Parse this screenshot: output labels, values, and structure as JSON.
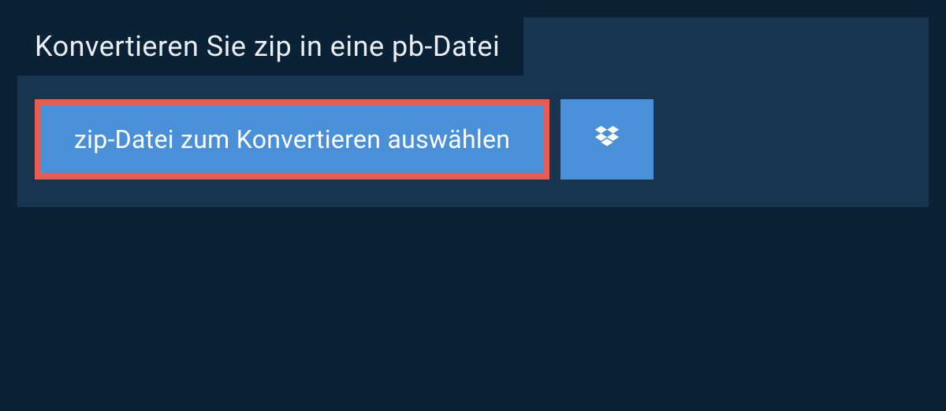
{
  "panel": {
    "title": "Konvertieren Sie zip in eine pb-Datei",
    "select_button_label": "zip-Datei zum Konvertieren auswählen",
    "dropbox_icon_name": "dropbox-icon"
  },
  "colors": {
    "page_bg": "#0b2236",
    "panel_bg": "#17354f",
    "button_bg": "#4a90d9",
    "button_border": "#e85d52",
    "text_light": "#ffffff"
  }
}
